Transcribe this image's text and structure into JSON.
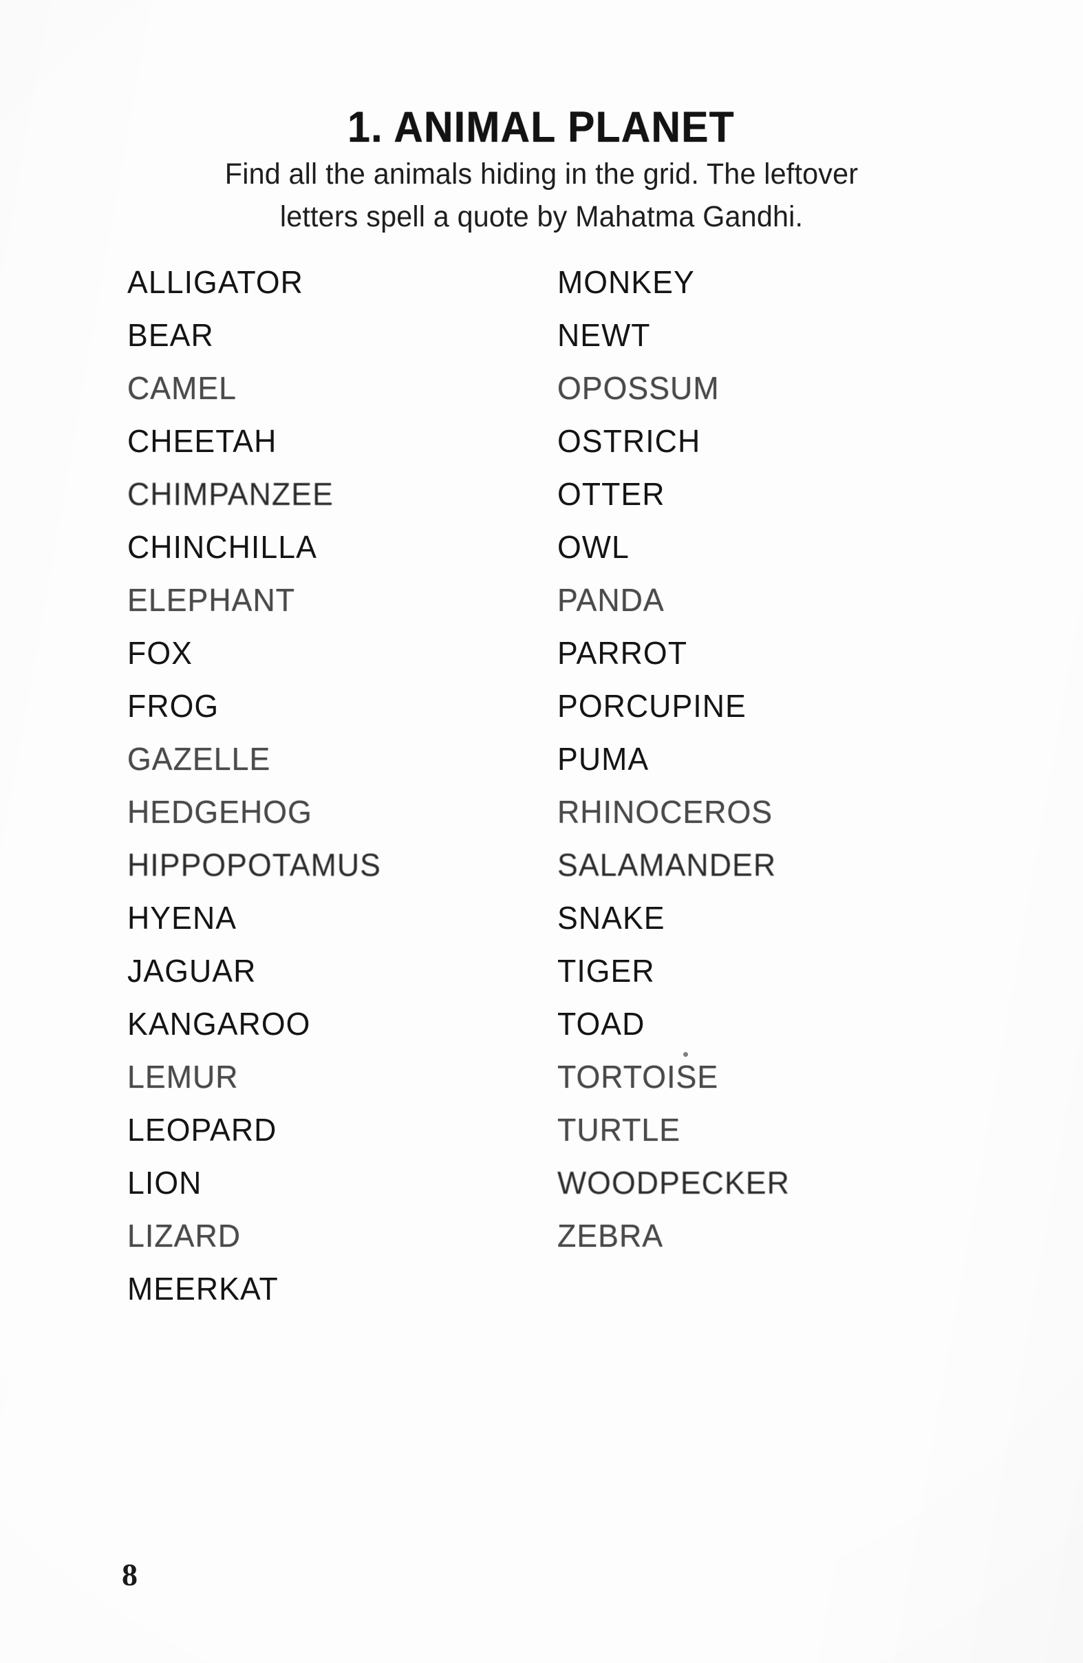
{
  "page": {
    "title": "1. ANIMAL PLANET",
    "page_number": "8",
    "background_color": "#fdfdfd",
    "text_color": "#141414"
  },
  "instructions": {
    "line1": "Find all the animals hiding in the grid. The leftover",
    "line2": "letters spell a quote by Mahatma Gandhi."
  },
  "word_list": {
    "left_column": [
      "ALLIGATOR",
      "BEAR",
      "CAMEL",
      "CHEETAH",
      "CHIMPANZEE",
      "CHINCHILLA",
      "ELEPHANT",
      "FOX",
      "FROG",
      "GAZELLE",
      "HEDGEHOG",
      "HIPPOPOTAMUS",
      "HYENA",
      "JAGUAR",
      "KANGAROO",
      "LEMUR",
      "LEOPARD",
      "LION",
      "LIZARD",
      "MEERKAT"
    ],
    "right_column": [
      "MONKEY",
      "NEWT",
      "OPOSSUM",
      "OSTRICH",
      "OTTER",
      "OWL",
      "PANDA",
      "PARROT",
      "PORCUPINE",
      "PUMA",
      "RHINOCEROS",
      "SALAMANDER",
      "SNAKE",
      "TIGER",
      "TOAD",
      "TORTOISE",
      "TURTLE",
      "WOODPECKER",
      "ZEBRA"
    ]
  }
}
